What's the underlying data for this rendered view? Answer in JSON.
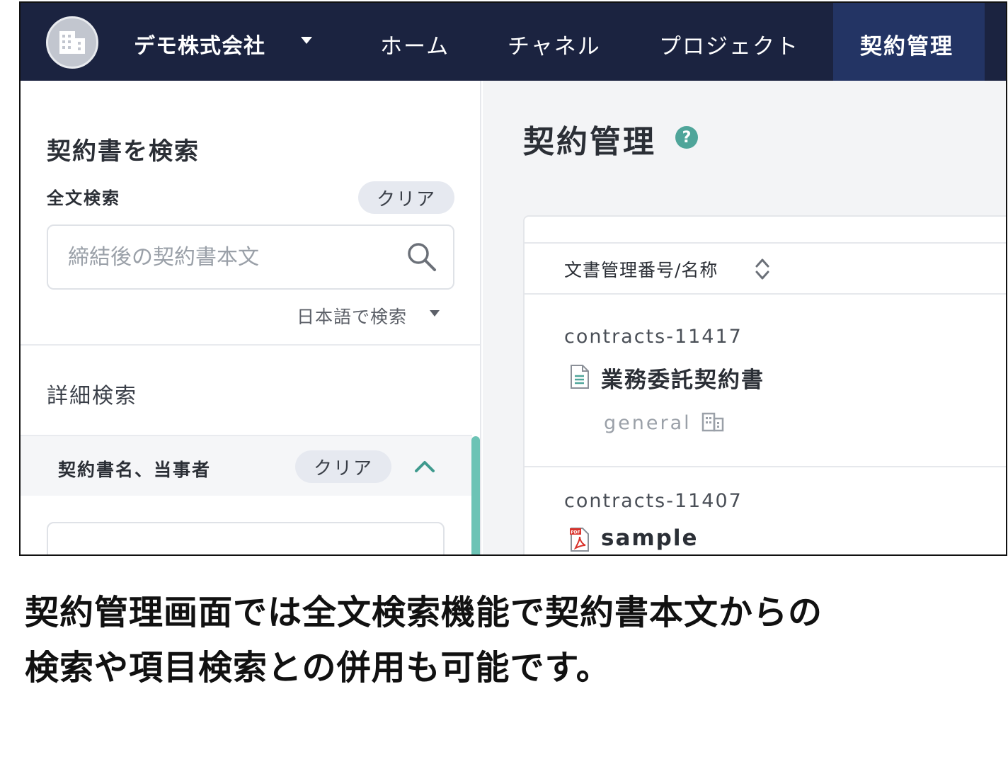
{
  "topnav": {
    "org_name": "デモ株式会社",
    "items": [
      "ホーム",
      "チャネル",
      "プロジェクト"
    ],
    "active_item": "契約管理"
  },
  "left": {
    "title": "契約書を検索",
    "fulltext_label": "全文検索",
    "clear_label": "クリア",
    "search_placeholder": "締結後の契約書本文",
    "search_value": "",
    "lang_select": "日本語で検索",
    "advanced_label": "詳細検索",
    "section_label": "契約書名、当事者",
    "section_clear": "クリア"
  },
  "main": {
    "page_title": "契約管理",
    "help": "?",
    "column_header": "文書管理番号/名称",
    "rows": [
      {
        "id": "contracts-11417",
        "name": "業務委託契約書",
        "tag": "general"
      },
      {
        "id": "contracts-11407",
        "name": "sample"
      }
    ]
  },
  "caption": {
    "line1": "契約管理画面では全文検索機能で契約書本文からの",
    "line2": "検索や項目検索との併用も可能です。"
  },
  "colors": {
    "nav_bg": "#1b2340",
    "nav_active_bg": "#233464",
    "accent_teal": "#4fa59a",
    "pdf_red": "#d9322b"
  }
}
